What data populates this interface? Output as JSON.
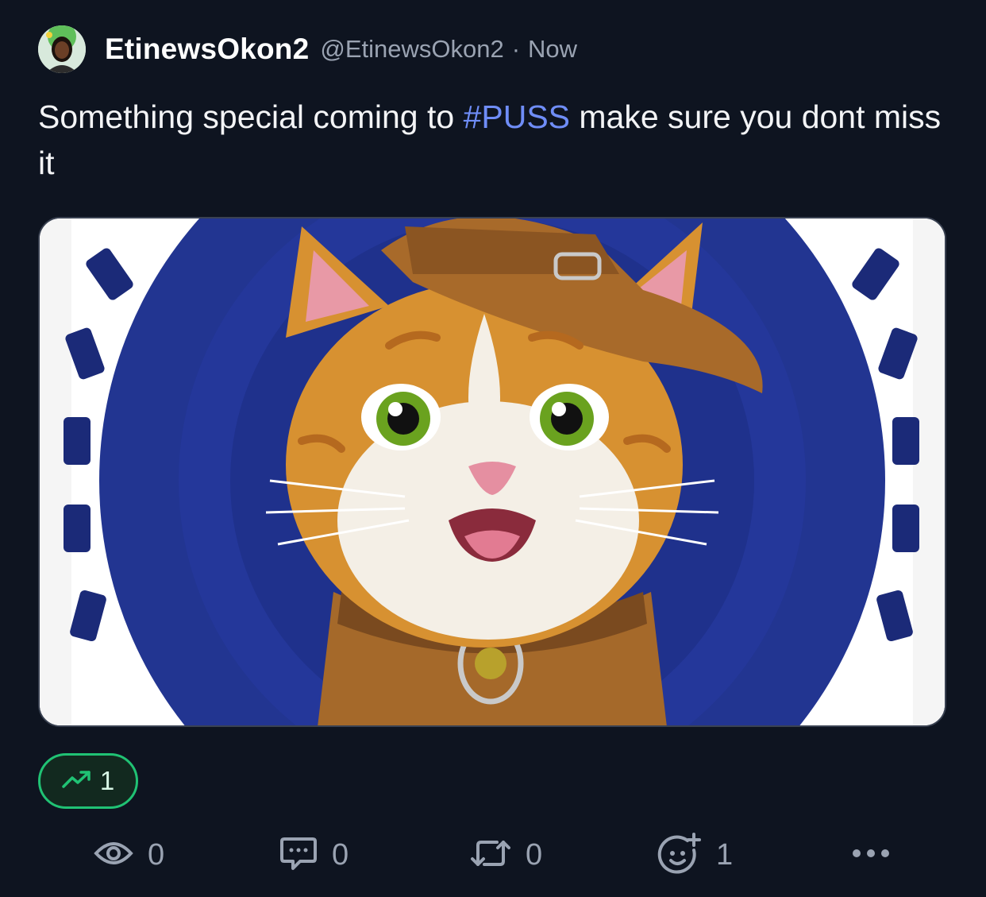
{
  "post": {
    "author": {
      "display_name": "EtinewsOkon2",
      "handle": "@EtinewsOkon2",
      "separator": "·",
      "timestamp": "Now"
    },
    "text_before": "Something special coming to ",
    "hashtag": "#PUSS",
    "text_after": " make sure you dont miss it",
    "media": {
      "description_icon": "cat-with-hat-coin-image"
    },
    "trend_badge": {
      "icon": "trending-up-icon",
      "count": "1",
      "color": "#20c274"
    },
    "actions": {
      "views": {
        "icon": "eye-icon",
        "count": "0"
      },
      "replies": {
        "icon": "chat-bubble-icon",
        "count": "0"
      },
      "reposts": {
        "icon": "repost-icon",
        "count": "0"
      },
      "reactions": {
        "icon": "add-reaction-icon",
        "count": "1"
      },
      "more": {
        "icon": "more-dots-icon"
      }
    }
  },
  "colors": {
    "background": "#0e1420",
    "hashtag": "#6f8df7",
    "muted": "#9aa3b2",
    "accent_green": "#20c274"
  }
}
